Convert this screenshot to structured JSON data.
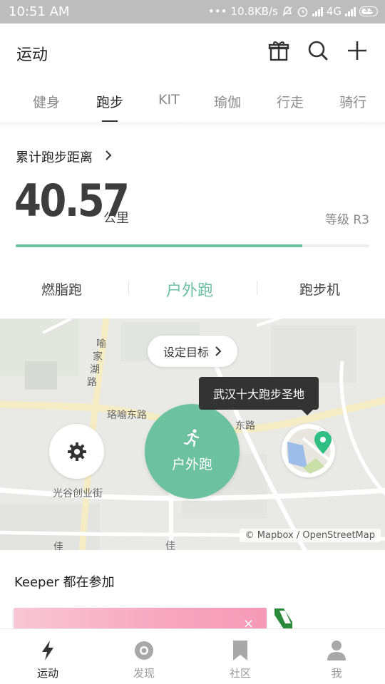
{
  "status_bar": {
    "time": "10:51 AM",
    "network_speed": "10.8KB/s",
    "network_type": "4G",
    "battery": "33"
  },
  "header": {
    "title": "运动",
    "icons": [
      "gift-icon",
      "search-icon",
      "plus-icon"
    ]
  },
  "tabs": [
    "健身",
    "跑步",
    "KIT",
    "瑜伽",
    "行走",
    "骑行"
  ],
  "active_tab": "跑步",
  "summary": {
    "label": "累计跑步距离",
    "value": "40.57",
    "unit": "公里",
    "level": "等级 R3",
    "level_progress": 0.81
  },
  "modes": [
    "燃脂跑",
    "户外跑",
    "跑步机"
  ],
  "active_mode": "户外跑",
  "map": {
    "goal_button": "设定目标",
    "start_button": "户外跑",
    "tooltip": "武汉十大跑步圣地",
    "attribution": "© Mapbox / OpenStreetMap",
    "road_labels": [
      "喻家湖路",
      "珞喻东路",
      "光谷创业街",
      "东路",
      "佳"
    ],
    "colors": {
      "accent": "#6cc1a0",
      "map_bg": "#e9eae6"
    }
  },
  "keeper": {
    "title": "Keeper 都在参加"
  },
  "bottom_nav": [
    {
      "label": "运动",
      "icon": "lightning-icon"
    },
    {
      "label": "发现",
      "icon": "discover-icon"
    },
    {
      "label": "社区",
      "icon": "bookmark-icon"
    },
    {
      "label": "我",
      "icon": "person-icon"
    }
  ]
}
